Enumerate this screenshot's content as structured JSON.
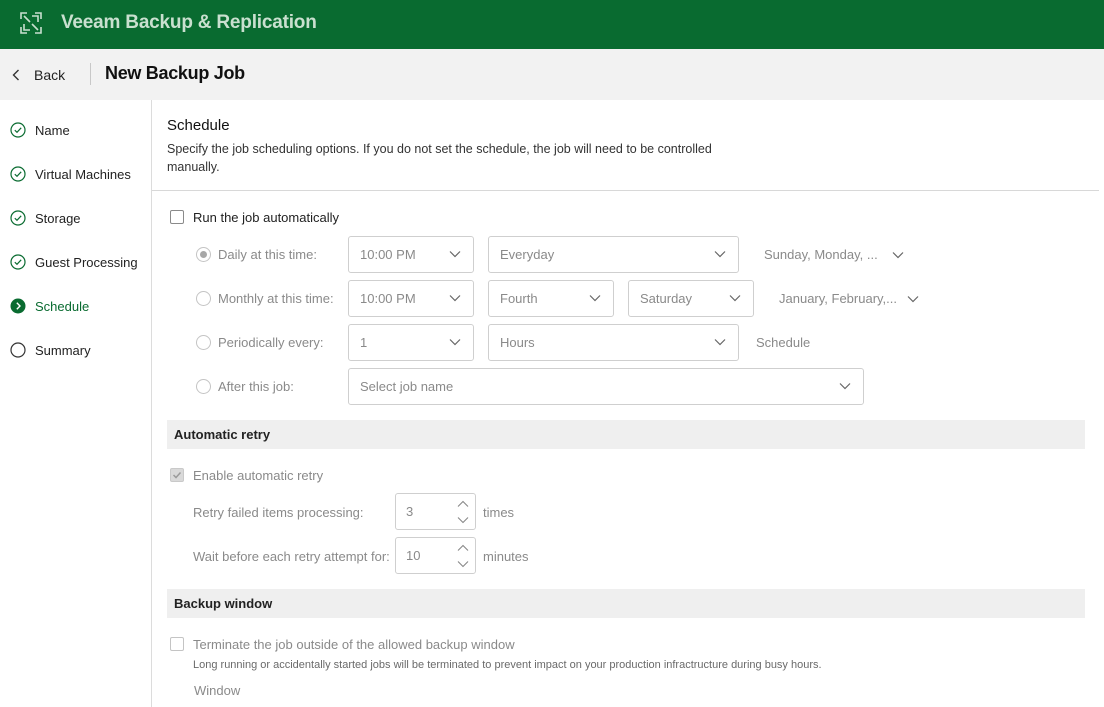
{
  "app": {
    "title": "Veeam Backup & Replication",
    "brand_color": "#096b30"
  },
  "header": {
    "back_label": "Back",
    "page_title": "New Backup Job"
  },
  "steps": [
    {
      "label": "Name",
      "state": "done"
    },
    {
      "label": "Virtual Machines",
      "state": "done"
    },
    {
      "label": "Storage",
      "state": "done"
    },
    {
      "label": "Guest Processing",
      "state": "done"
    },
    {
      "label": "Schedule",
      "state": "active"
    },
    {
      "label": "Summary",
      "state": "pending"
    }
  ],
  "schedule": {
    "title": "Schedule",
    "description": "Specify the job scheduling options. If you do not set the schedule, the job will need to be controlled manually.",
    "run_auto_label": "Run the job automatically",
    "run_auto_checked": false,
    "daily": {
      "label": "Daily at this time:",
      "time": "10:00 PM",
      "frequency": "Everyday",
      "days": "Sunday, Monday, ...",
      "selected": true
    },
    "monthly": {
      "label": "Monthly at this time:",
      "time": "10:00 PM",
      "week": "Fourth",
      "day": "Saturday",
      "months": "January, February,..."
    },
    "periodic": {
      "label": "Periodically every:",
      "value": "1",
      "unit": "Hours",
      "link": "Schedule"
    },
    "after": {
      "label": "After this job:",
      "placeholder": "Select job name"
    }
  },
  "retry": {
    "title": "Automatic retry",
    "enable_label": "Enable automatic retry",
    "enable_checked": true,
    "retry_label": "Retry failed items processing:",
    "retry_value": "3",
    "retry_unit": "times",
    "wait_label": "Wait before each retry attempt for:",
    "wait_value": "10",
    "wait_unit": "minutes"
  },
  "window": {
    "title": "Backup window",
    "terminate_label": "Terminate the job outside of the allowed backup window",
    "terminate_checked": false,
    "hint": "Long running or accidentally started jobs will be terminated to prevent impact on your production infractructure during busy hours.",
    "window_label": "Window"
  }
}
